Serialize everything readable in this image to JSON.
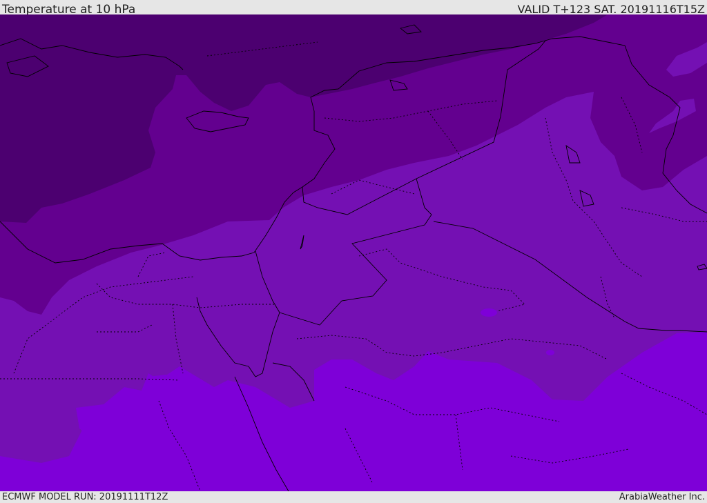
{
  "header": {
    "title": "Temperature at 10 hPa",
    "valid": "VALID T+123 SAT. 20191116T15Z"
  },
  "footer": {
    "model_run": "ECMWF MODEL RUN: 20191111T12Z",
    "credit": "ArabiaWeather Inc."
  },
  "map": {
    "colors": {
      "coldest": "#4c0070",
      "cold": "#63008f",
      "mid": "#7410b3",
      "warm": "#7e00d8",
      "borders": "#000000"
    }
  }
}
